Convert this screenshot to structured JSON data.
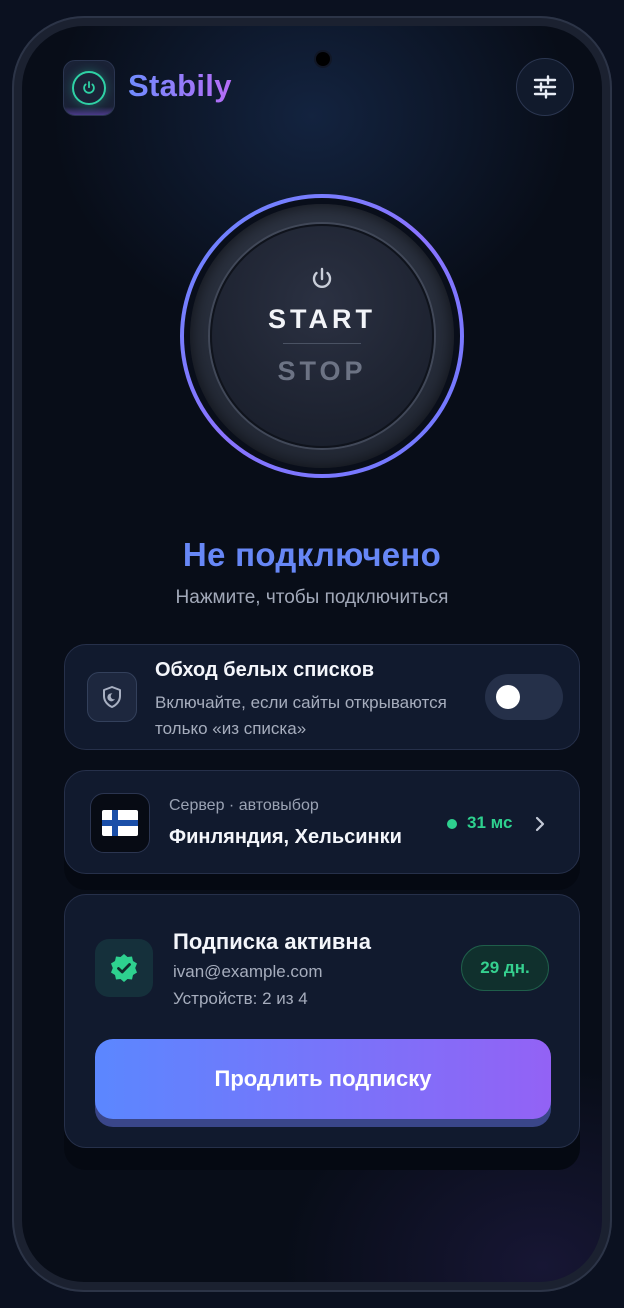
{
  "app": {
    "name": "Stabily"
  },
  "header": {
    "logo_icon": "power-icon",
    "settings_icon": "sliders-icon"
  },
  "power_button": {
    "icon": "power-icon",
    "start_label": "START",
    "stop_label": "STOP"
  },
  "status": {
    "title": "Не подключено",
    "subtitle": "Нажмите, чтобы подключиться"
  },
  "whitelist": {
    "icon": "shield-icon",
    "title": "Обход белых списков",
    "description": "Включайте, если сайты открываются только «из списка»",
    "enabled": false
  },
  "server": {
    "label": "Сервер · автовыбор",
    "name": "Финляндия, Хельсинки",
    "flag": "finland-flag",
    "ping": "31 мс",
    "chevron_icon": "chevron-right-icon"
  },
  "subscription": {
    "icon": "verified-badge-icon",
    "title": "Подписка активна",
    "email": "ivan@example.com",
    "devices": "Устройств: 2 из 4",
    "days_left": "29 дн.",
    "renew_label": "Продлить подписку"
  },
  "colors": {
    "accent_blue": "#6787f6",
    "accent_purple": "#9362f5",
    "success_green": "#2ed18f",
    "background": "#080d18",
    "card": "#111a2e"
  }
}
